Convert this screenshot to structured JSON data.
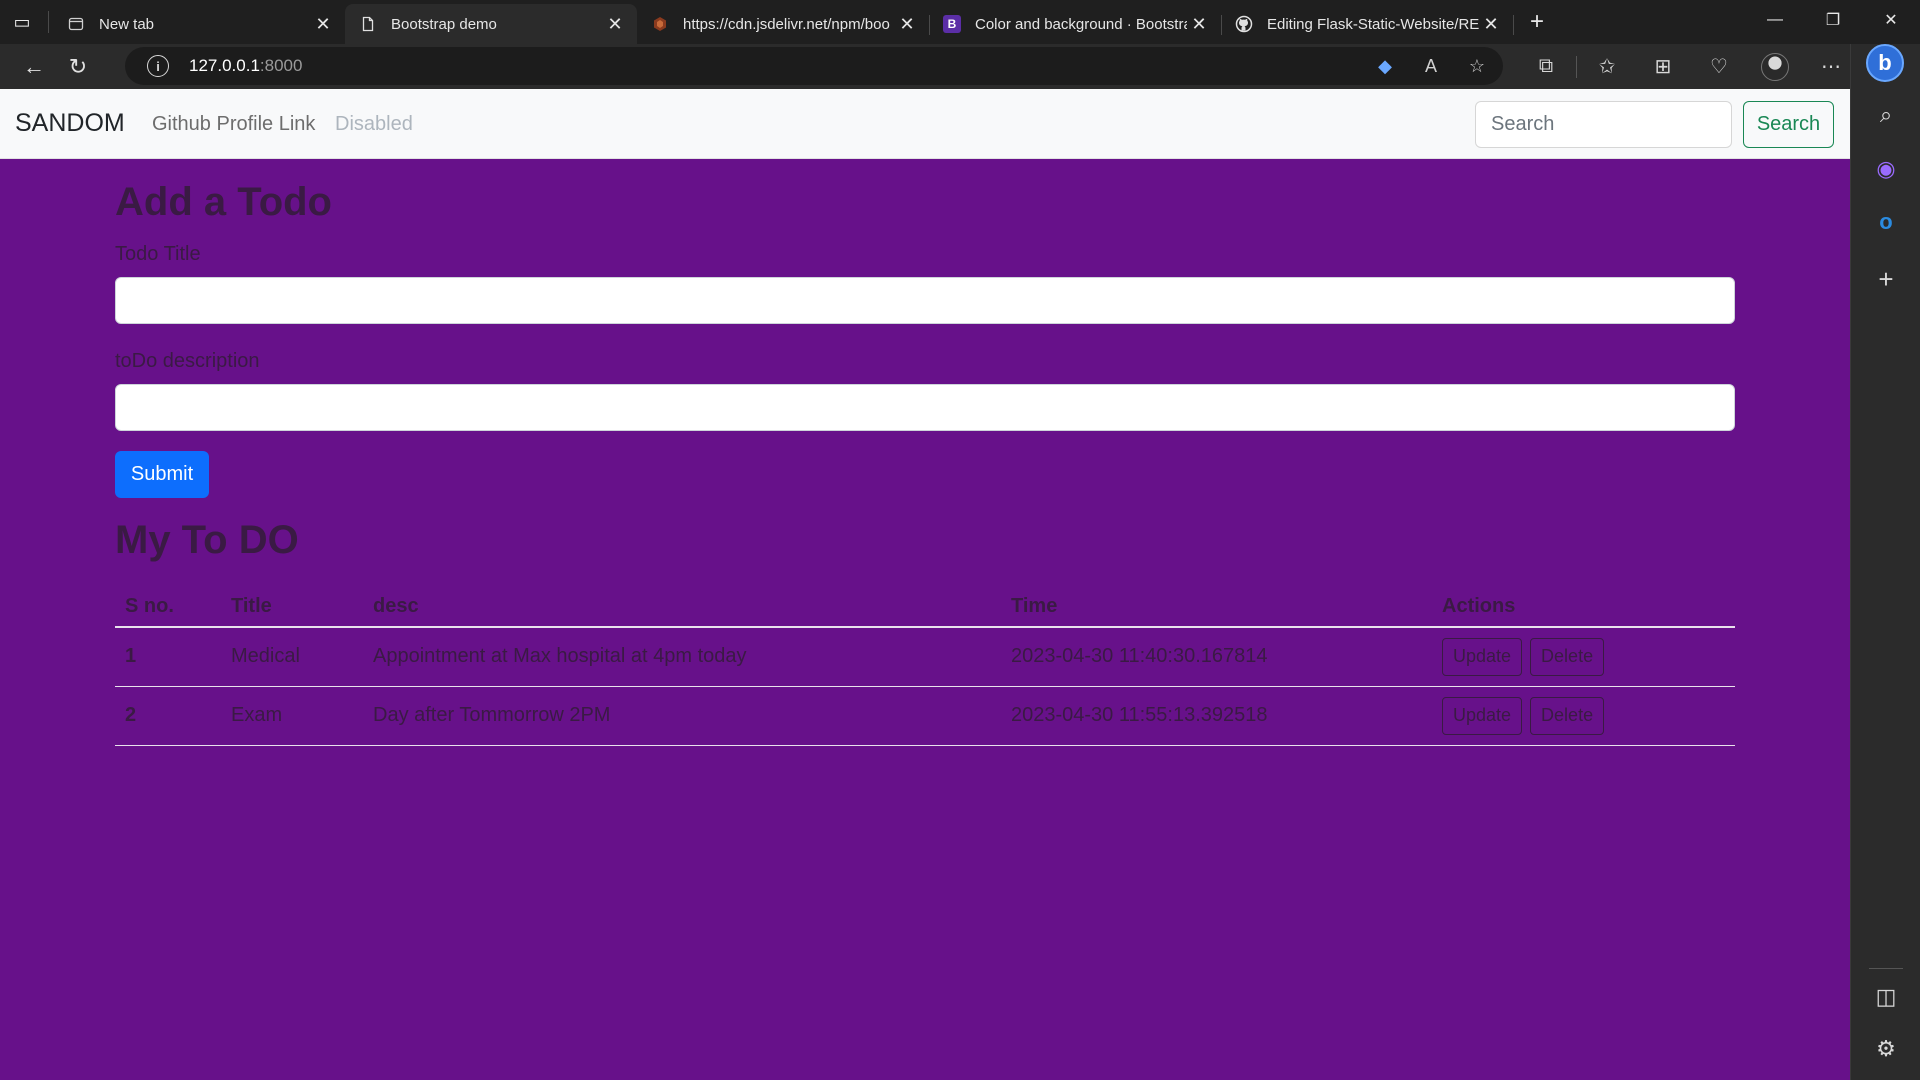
{
  "browser": {
    "tabs": [
      {
        "title": "New tab",
        "favicon": "newtab-page-icon",
        "active": false
      },
      {
        "title": "Bootstrap demo",
        "favicon": "document-icon",
        "active": true
      },
      {
        "title": "https://cdn.jsdelivr.net/npm/boo",
        "favicon": "jsdelivr-icon",
        "active": false
      },
      {
        "title": "Color and background · Bootstra",
        "favicon": "bootstrap-icon",
        "active": false
      },
      {
        "title": "Editing Flask-Static-Website/REA",
        "favicon": "github-icon",
        "active": false
      }
    ],
    "address": {
      "host": "127.0.0.1",
      "port": ":8000"
    }
  },
  "navbar": {
    "brand": "SANDOM",
    "links": [
      {
        "label": "Github Profile Link",
        "disabled": false
      },
      {
        "label": "Disabled",
        "disabled": true
      }
    ],
    "search_placeholder": "Search",
    "search_button": "Search"
  },
  "form": {
    "heading": "Add a Todo",
    "title_label": "Todo Title",
    "title_value": "",
    "desc_label": "toDo description",
    "desc_value": "",
    "submit_label": "Submit"
  },
  "todos": {
    "heading": "My To DO",
    "columns": [
      "S no.",
      "Title",
      "desc",
      "Time",
      "Actions"
    ],
    "rows": [
      {
        "sno": "1",
        "title": "Medical",
        "desc": "Appointment at Max hospital at 4pm today",
        "time": "2023-04-30 11:40:30.167814"
      },
      {
        "sno": "2",
        "title": "Exam",
        "desc": "Day after Tommorrow 2PM",
        "time": "2023-04-30 11:55:13.392518"
      }
    ],
    "update_label": "Update",
    "delete_label": "Delete"
  },
  "colors": {
    "page_background": "#67118a",
    "navbar_background": "#f8f9fa",
    "primary_button": "#0d6efd",
    "success_outline": "#198754"
  }
}
